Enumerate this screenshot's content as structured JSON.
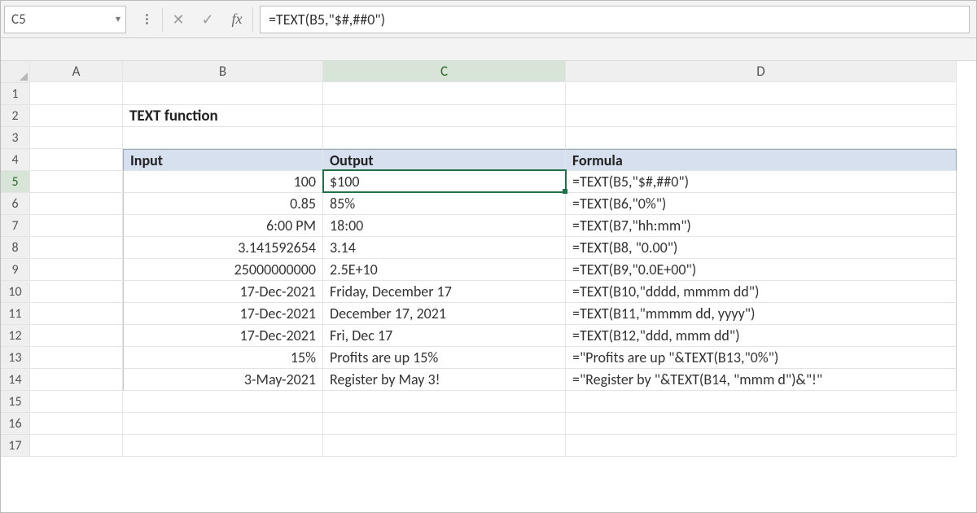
{
  "name_box": "C5",
  "formula_bar": "=TEXT(B5,\"$#,##0\")",
  "column_headers": [
    "A",
    "B",
    "C",
    "D"
  ],
  "row_headers": [
    "1",
    "2",
    "3",
    "4",
    "5",
    "6",
    "7",
    "8",
    "9",
    "10",
    "11",
    "12",
    "13",
    "14",
    "15",
    "16",
    "17"
  ],
  "title": "TEXT function",
  "headers": {
    "input": "Input",
    "output": "Output",
    "formula": "Formula"
  },
  "rows": [
    {
      "input": "100",
      "output": "$100",
      "formula": "=TEXT(B5,\"$#,##0\")"
    },
    {
      "input": "0.85",
      "output": "85%",
      "formula": "=TEXT(B6,\"0%\")"
    },
    {
      "input": "6:00 PM",
      "output": "18:00",
      "formula": "=TEXT(B7,\"hh:mm\")"
    },
    {
      "input": "3.141592654",
      "output": "3.14",
      "formula": "=TEXT(B8, \"0.00\")"
    },
    {
      "input": "25000000000",
      "output": "2.5E+10",
      "formula": "=TEXT(B9,\"0.0E+00\")"
    },
    {
      "input": "17-Dec-2021",
      "output": "Friday, December 17",
      "formula": "=TEXT(B10,\"dddd, mmmm dd\")"
    },
    {
      "input": "17-Dec-2021",
      "output": "December 17, 2021",
      "formula": "=TEXT(B11,\"mmmm dd, yyyy\")"
    },
    {
      "input": "17-Dec-2021",
      "output": "Fri, Dec 17",
      "formula": "=TEXT(B12,\"ddd, mmm dd\")"
    },
    {
      "input": "15%",
      "output": "Profits are up 15%",
      "formula": "=\"Profits are up \"&TEXT(B13,\"0%\")"
    },
    {
      "input": "3-May-2021",
      "output": "Register by May 3!",
      "formula": "=\"Register by \"&TEXT(B14, \"mmm d\")&\"!\""
    }
  ],
  "active": {
    "cell": "C5",
    "row_index": 5,
    "col_index": 3
  }
}
